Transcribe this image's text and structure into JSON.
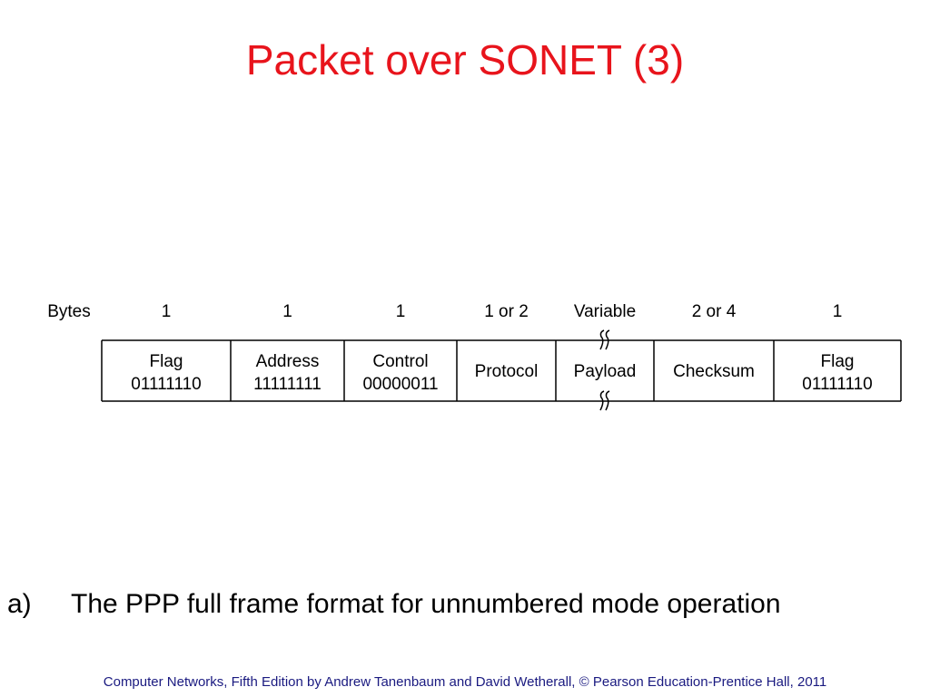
{
  "slide": {
    "title": "Packet over SONET (3)",
    "caption_label": "a)",
    "caption_text": "The PPP full frame format for unnumbered mode operation",
    "footer": "Computer Networks, Fifth Edition by Andrew Tanenbaum and David Wetherall, © Pearson Education-Prentice Hall, 2011"
  },
  "frame": {
    "bytes_label": "Bytes",
    "fields": [
      {
        "name": "Flag",
        "value": "01111110",
        "bytes": "1"
      },
      {
        "name": "Address",
        "value": "11111111",
        "bytes": "1"
      },
      {
        "name": "Control",
        "value": "00000011",
        "bytes": "1"
      },
      {
        "name": "Protocol",
        "value": "",
        "bytes": "1 or 2"
      },
      {
        "name": "Payload",
        "value": "",
        "bytes": "Variable",
        "variable_length": true
      },
      {
        "name": "Checksum",
        "value": "",
        "bytes": "2 or 4"
      },
      {
        "name": "Flag",
        "value": "01111110",
        "bytes": "1"
      }
    ]
  }
}
